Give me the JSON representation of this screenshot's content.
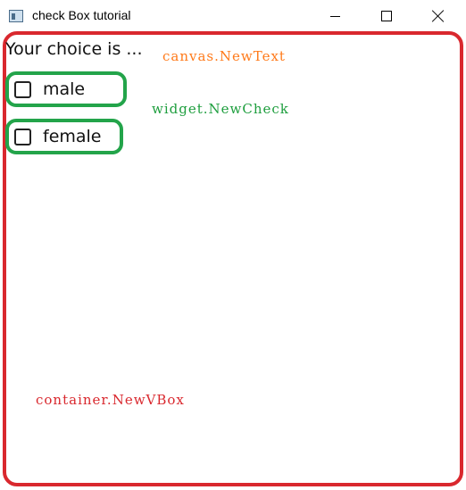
{
  "window": {
    "title": "check Box tutorial"
  },
  "content": {
    "choice_label": "Your choice is ...",
    "checkboxes": [
      {
        "label": "male",
        "checked": false
      },
      {
        "label": "female",
        "checked": false
      }
    ]
  },
  "annotations": {
    "canvas": "canvas.NewText",
    "widget": "widget.NewCheck",
    "container": "container.NewVBox"
  },
  "colors": {
    "vbox_outline": "#d9282e",
    "check_outline": "#23a44a",
    "canvas_annotation": "#ff7a1a",
    "widget_annotation": "#1e9e3e",
    "container_annotation": "#d9282e"
  },
  "icons": {
    "app": "app-window-icon",
    "minimize": "minimize-icon",
    "maximize": "maximize-icon",
    "close": "close-icon"
  }
}
